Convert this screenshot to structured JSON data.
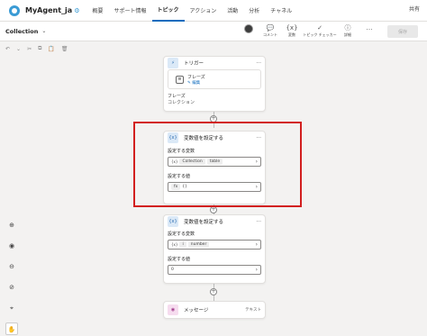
{
  "app": {
    "name": "MyAgent_ja"
  },
  "nav": [
    "概要",
    "サポート情報",
    "トピック",
    "アクション",
    "活動",
    "分析",
    "チャネル"
  ],
  "nav_active": 2,
  "topright": "共有",
  "subbar": {
    "title": "Collection",
    "tools": [
      {
        "icon": "person-avatar",
        "label": ""
      },
      {
        "icon": "comment-icon",
        "glyph": "💬",
        "label": "コメント"
      },
      {
        "icon": "variable-icon",
        "glyph": "{x}",
        "label": "変数"
      },
      {
        "icon": "topic-checker-icon",
        "glyph": "✓",
        "label": "トピック チェッカー"
      },
      {
        "icon": "details-icon",
        "glyph": "ⓘ",
        "label": "詳細"
      },
      {
        "icon": "more-icon",
        "glyph": "…",
        "label": ""
      }
    ],
    "save": "保存"
  },
  "trigger_card": {
    "title": "トリガー",
    "phrase_title": "フレーズ",
    "edit_link": "✎ 編集",
    "phrases_label": "フレーズ",
    "phrases_value": "コレクション"
  },
  "card1": {
    "title": "変数値を設定する",
    "var_label": "設定する変数",
    "var_value": "Collection",
    "var_type": "table",
    "val_label": "設定する値",
    "val_value": "{}"
  },
  "card2": {
    "title": "変数値を設定する",
    "var_label": "設定する変数",
    "var_value": "i",
    "var_type": "number",
    "val_label": "設定する値",
    "val_value": "0"
  },
  "message_card": {
    "title": "メッセージ",
    "right": "テキスト"
  },
  "colors": {
    "accent": "#0f6cbd",
    "highlight": "#d21f1f"
  }
}
